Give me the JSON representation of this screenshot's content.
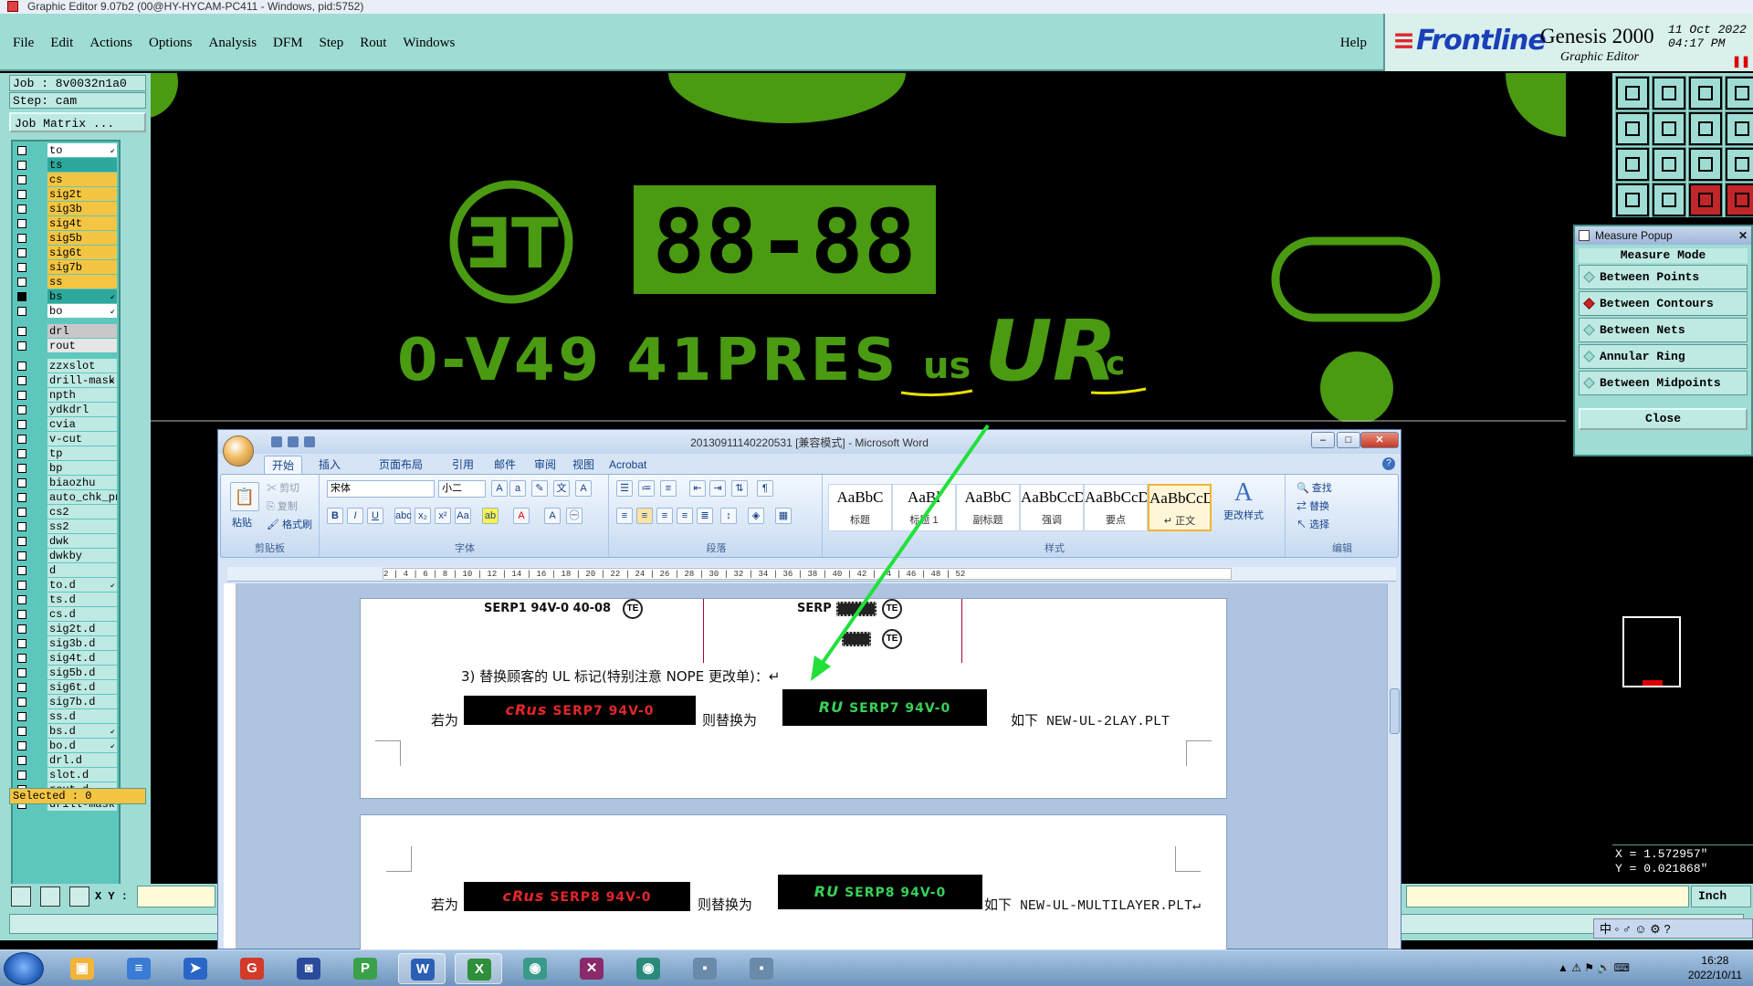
{
  "genesis": {
    "title": "Graphic Editor 9.07b2 (00@HY-HYCAM-PC411 - Windows, pid:5752)",
    "menu": [
      "File",
      "Edit",
      "Actions",
      "Options",
      "Analysis",
      "DFM",
      "Step",
      "Rout",
      "Windows"
    ],
    "help": "Help",
    "brand_logo": "Frontline",
    "product": "Genesis 2000",
    "product_sub": "Graphic Editor",
    "date": "11 Oct 2022",
    "time": "04:17 PM",
    "job": "Job : 8v0032n1a0",
    "step": "Step: cam",
    "job_matrix": "Job Matrix ...",
    "layers": [
      {
        "name": "to",
        "color": "#ffffff",
        "arrow": "↙",
        "on": false
      },
      {
        "name": "ts",
        "color": "#2ea89c",
        "arrow": "",
        "on": false
      },
      {
        "name": "cs",
        "color": "#f4c542",
        "arrow": "",
        "on": false
      },
      {
        "name": "sig2t",
        "color": "#f4c542",
        "arrow": "",
        "on": false
      },
      {
        "name": "sig3b",
        "color": "#f4c542",
        "arrow": "",
        "on": false
      },
      {
        "name": "sig4t",
        "color": "#f4c542",
        "arrow": "",
        "on": false
      },
      {
        "name": "sig5b",
        "color": "#f4c542",
        "arrow": "",
        "on": false
      },
      {
        "name": "sig6t",
        "color": "#f4c542",
        "arrow": "",
        "on": false
      },
      {
        "name": "sig7b",
        "color": "#f4c542",
        "arrow": "",
        "on": false
      },
      {
        "name": "ss",
        "color": "#f4c542",
        "arrow": "",
        "on": false
      },
      {
        "name": "bs",
        "color": "#2ea89c",
        "arrow": "↙",
        "on": true
      },
      {
        "name": "bo",
        "color": "#ffffff",
        "arrow": "↙",
        "on": false
      },
      {
        "gap": true
      },
      {
        "name": "drl",
        "color": "#c8c8c8",
        "arrow": "",
        "on": false
      },
      {
        "name": "rout",
        "color": "#e6e6e6",
        "arrow": "",
        "on": false
      },
      {
        "gap": true
      },
      {
        "name": "zzxslot",
        "color": "#bfe9e3",
        "arrow": "",
        "on": false
      },
      {
        "name": "drill-mask",
        "color": "#bfe9e3",
        "arrow": "↙",
        "on": false
      },
      {
        "name": "npth",
        "color": "#bfe9e3",
        "arrow": "",
        "on": false
      },
      {
        "name": "ydkdrl",
        "color": "#bfe9e3",
        "arrow": "",
        "on": false
      },
      {
        "name": "cvia",
        "color": "#bfe9e3",
        "arrow": "",
        "on": false
      },
      {
        "name": "v-cut",
        "color": "#bfe9e3",
        "arrow": "",
        "on": false
      },
      {
        "name": "tp",
        "color": "#bfe9e3",
        "arrow": "",
        "on": false
      },
      {
        "name": "bp",
        "color": "#bfe9e3",
        "arrow": "",
        "on": false
      },
      {
        "name": "biaozhu",
        "color": "#bfe9e3",
        "arrow": "",
        "on": false
      },
      {
        "name": "auto_chk_pn",
        "color": "#bfe9e3",
        "arrow": "",
        "on": false
      },
      {
        "name": "cs2",
        "color": "#bfe9e3",
        "arrow": "",
        "on": false
      },
      {
        "name": "ss2",
        "color": "#bfe9e3",
        "arrow": "",
        "on": false
      },
      {
        "name": "dwk",
        "color": "#bfe9e3",
        "arrow": "",
        "on": false
      },
      {
        "name": "dwkby",
        "color": "#bfe9e3",
        "arrow": "",
        "on": false
      },
      {
        "name": "d",
        "color": "#bfe9e3",
        "arrow": "",
        "on": false
      },
      {
        "name": "to.d",
        "color": "#bfe9e3",
        "arrow": "↙",
        "on": false
      },
      {
        "name": "ts.d",
        "color": "#bfe9e3",
        "arrow": "",
        "on": false
      },
      {
        "name": "cs.d",
        "color": "#bfe9e3",
        "arrow": "",
        "on": false
      },
      {
        "name": "sig2t.d",
        "color": "#bfe9e3",
        "arrow": "",
        "on": false
      },
      {
        "name": "sig3b.d",
        "color": "#bfe9e3",
        "arrow": "",
        "on": false
      },
      {
        "name": "sig4t.d",
        "color": "#bfe9e3",
        "arrow": "",
        "on": false
      },
      {
        "name": "sig5b.d",
        "color": "#bfe9e3",
        "arrow": "",
        "on": false
      },
      {
        "name": "sig6t.d",
        "color": "#bfe9e3",
        "arrow": "",
        "on": false
      },
      {
        "name": "sig7b.d",
        "color": "#bfe9e3",
        "arrow": "",
        "on": false
      },
      {
        "name": "ss.d",
        "color": "#bfe9e3",
        "arrow": "",
        "on": false
      },
      {
        "name": "bs.d",
        "color": "#bfe9e3",
        "arrow": "↙",
        "on": false
      },
      {
        "name": "bo.d",
        "color": "#bfe9e3",
        "arrow": "↙",
        "on": false
      },
      {
        "name": "drl.d",
        "color": "#bfe9e3",
        "arrow": "",
        "on": false
      },
      {
        "name": "slot.d",
        "color": "#bfe9e3",
        "arrow": "",
        "on": false
      },
      {
        "name": "rout.d",
        "color": "#bfe9e3",
        "arrow": "",
        "on": false
      },
      {
        "name": "drill-mask.d",
        "color": "#bfe9e3",
        "arrow": "",
        "on": false
      }
    ],
    "selected": "Selected : 0",
    "xy_label": "X Y :",
    "units": "Inch",
    "coord_x": "X = 1.572957\"",
    "coord_y": "Y = 0.021868\"",
    "canvas_text": "0-V49 41PRES",
    "canvas_code": "88-88",
    "canvas_te": "ƎT",
    "canvas_us": "us",
    "canvas_ul": "UR",
    "canvas_c": "c",
    "accent_green": "#4a9a12",
    "annotation_color": "#e8e000"
  },
  "measure_popup": {
    "title": "Measure Popup",
    "mode_label": "Measure Mode",
    "options": [
      "Between Points",
      "Between Contours",
      "Between Nets",
      "Annular Ring",
      "Between Midpoints"
    ],
    "selected_option": "Between Contours",
    "close": "Close"
  },
  "word": {
    "title": "20130911140220531 [兼容模式] - Microsoft Word",
    "tabs": [
      "开始",
      "插入",
      "页面布局",
      "引用",
      "邮件",
      "审阅",
      "视图",
      "Acrobat"
    ],
    "active_tab": "开始",
    "clipboard": {
      "paste": "粘贴",
      "cut": "剪切",
      "copy": "复制",
      "painter": "格式刷",
      "group": "剪贴板"
    },
    "font": {
      "name": "宋体",
      "size": "小二",
      "group": "字体"
    },
    "paragraph_group": "段落",
    "styles": [
      {
        "sample": "AaBbC",
        "name": "标题"
      },
      {
        "sample": "AaBl",
        "name": "标题 1"
      },
      {
        "sample": "AaBbC",
        "name": "副标题"
      },
      {
        "sample": "AaBbCcDi",
        "name": "强调"
      },
      {
        "sample": "AaBbCcD",
        "name": "要点"
      },
      {
        "sample": "AaBbCcDc",
        "name": "↵ 正文"
      }
    ],
    "styles_group": "样式",
    "change_styles": "更改样式",
    "editing": {
      "find": "查找",
      "replace": "替换",
      "select": "选择",
      "group": "编辑"
    },
    "ruler": "2 | 4 | 6 | 8 | 10 | 12 | 14 | 16 | 18 | 20 | 22 | 24 | 26 | 28 | 30 | 32 | 34 | 36 | 38 | 40 | 42 | 44 | 46 | 48 | 52",
    "doc": {
      "line1_left": "SERP1 94V-0  40-08",
      "line1_right": "SERP",
      "item3": "3) 替换顾客的 UL 标记(特别注意 NOPE 更改单)：↵",
      "if_label": "若为",
      "replace_label": "则替换为",
      "badge_ul": "cRus",
      "badge_ul2": "RU",
      "red1": "SERP7  94V-0",
      "green1": "SERP7  94V-0",
      "note1": "如下 NEW-UL-2LAY.PLT",
      "red2": "SERP8  94V-0",
      "green2": "SERP8  94V-0",
      "note2": "如下 NEW-UL-MULTILAYER.PLT↵",
      "te": "TE"
    }
  },
  "taskbar": {
    "time": "16:28",
    "date": "2022/10/11",
    "ime": "中",
    "apps": [
      {
        "name": "folder",
        "glyph": "▣",
        "color": "#f2b43a"
      },
      {
        "name": "notepad",
        "glyph": "≡",
        "color": "#3a7bd5"
      },
      {
        "name": "arrow-app",
        "glyph": "➤",
        "color": "#2a66c8"
      },
      {
        "name": "g-app",
        "glyph": "G",
        "color": "#d43a2a"
      },
      {
        "name": "save-app",
        "glyph": "◙",
        "color": "#2a4a9a"
      },
      {
        "name": "p-app",
        "glyph": "P",
        "color": "#3aa04a"
      },
      {
        "name": "word",
        "glyph": "W",
        "color": "#2b5fb4"
      },
      {
        "name": "excel",
        "glyph": "X",
        "color": "#2f8f3a"
      },
      {
        "name": "eye-app",
        "glyph": "◉",
        "color": "#3a9a8a"
      },
      {
        "name": "cross-app",
        "glyph": "✕",
        "color": "#8a2a6a"
      },
      {
        "name": "eye-app-2",
        "glyph": "◉",
        "color": "#2a8a7a"
      },
      {
        "name": "app-12",
        "glyph": "▪",
        "color": "#6a8aaa"
      },
      {
        "name": "app-13",
        "glyph": "▪",
        "color": "#6a8aaa"
      }
    ]
  }
}
